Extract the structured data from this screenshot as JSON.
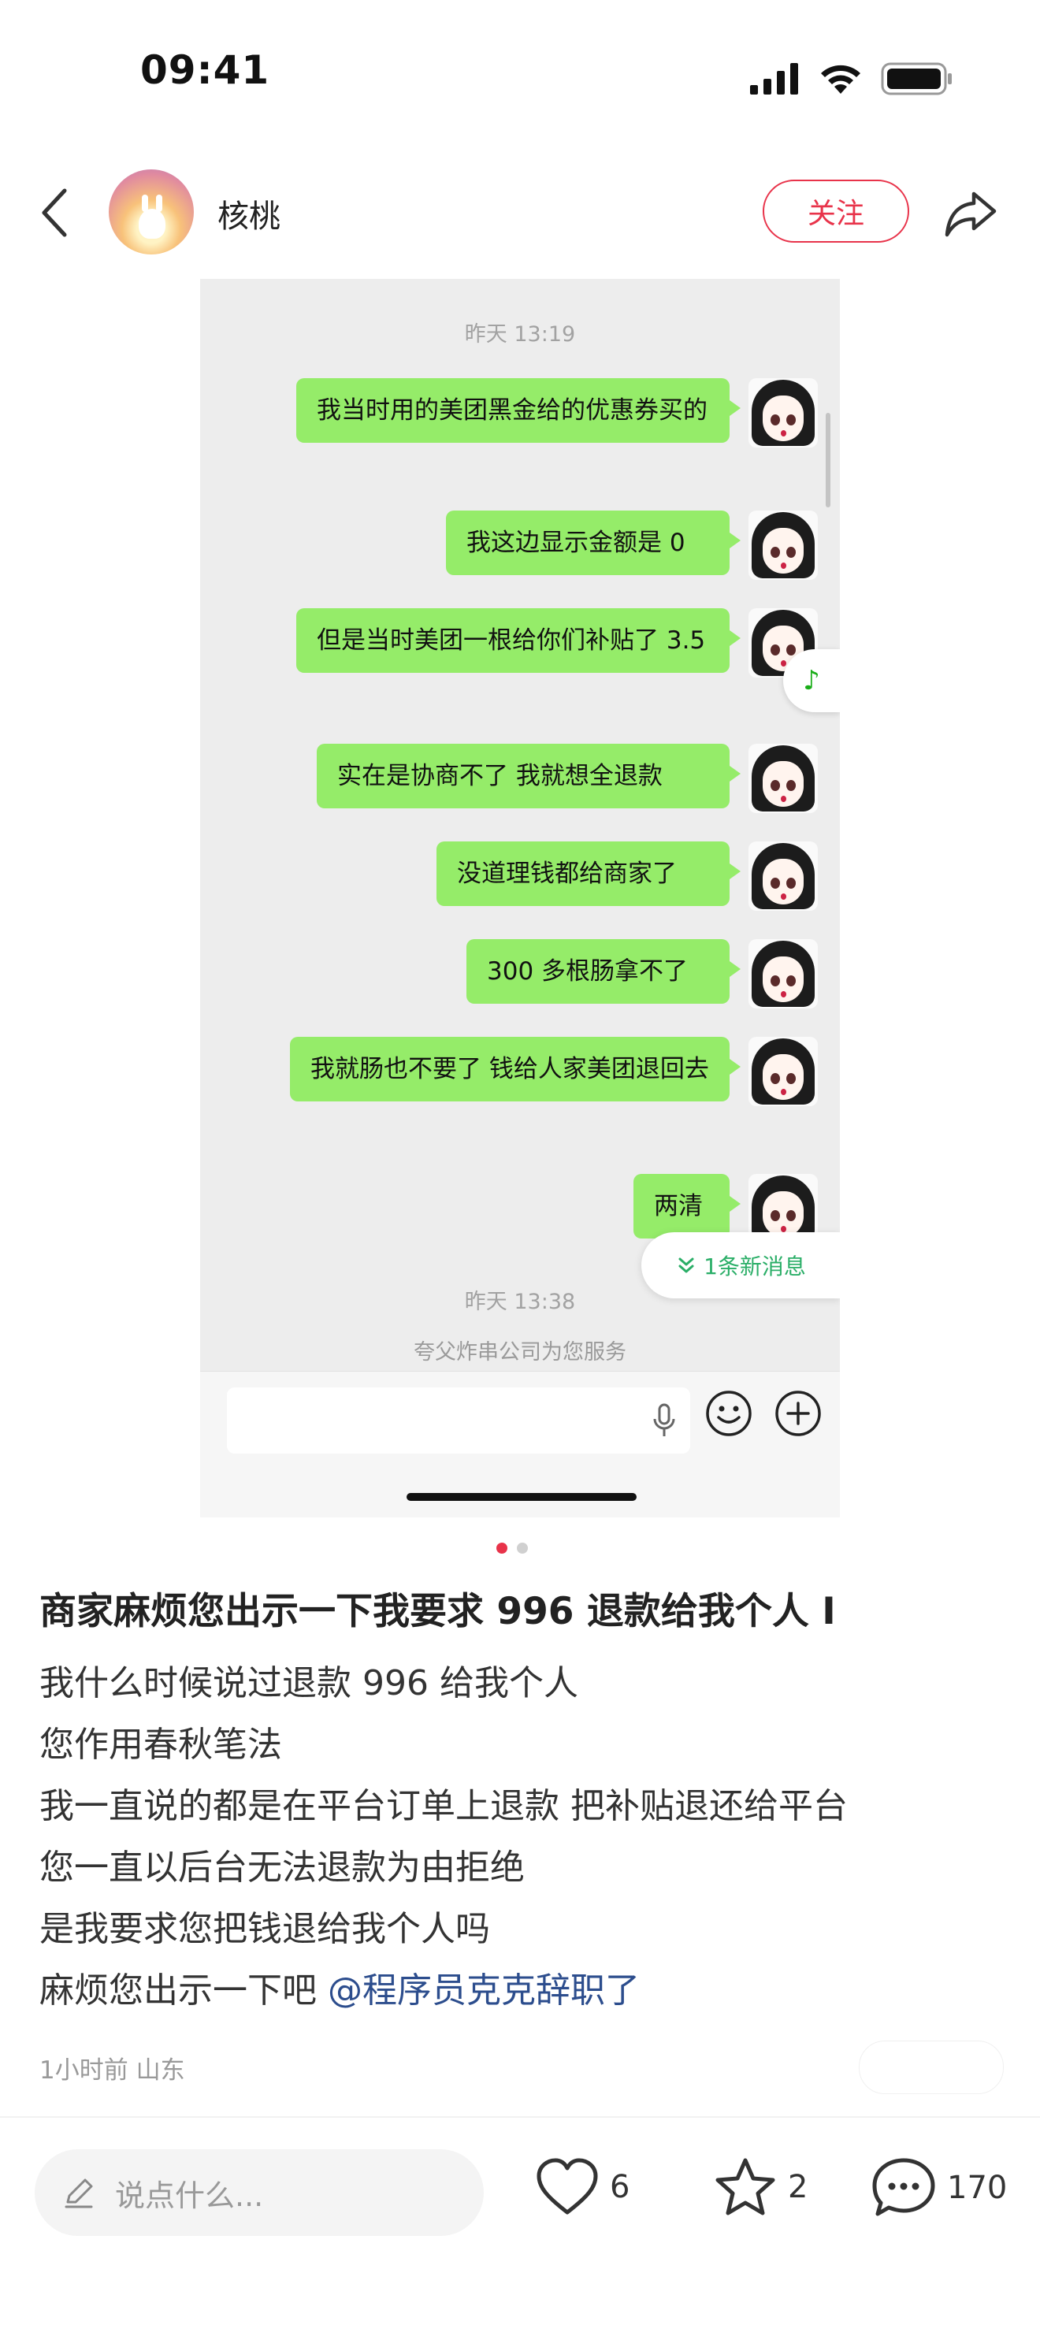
{
  "status_bar": {
    "time": "09:41"
  },
  "header": {
    "username": "核桃",
    "follow_label": "关注"
  },
  "chat": {
    "timestamp_top": "昨天 13:19",
    "messages": [
      {
        "text": "我当时用的美团黑金给的优惠券买的"
      },
      {
        "text": "我这边显示金额是 0"
      },
      {
        "text": "但是当时美团一根给你们补贴了 3.5"
      },
      {
        "text": "实在是协商不了 我就想全退款"
      },
      {
        "text": "没道理钱都给商家了"
      },
      {
        "text": "300 多根肠拿不了"
      },
      {
        "text": "我就肠也不要了 钱给人家美团退回去"
      },
      {
        "text": "两清"
      }
    ],
    "new_message_label": "1条新消息",
    "timestamp_bottom": "昨天 13:38",
    "service_text": "夸父炸串公司为您服务"
  },
  "pager": {
    "active_color": "#e8334a",
    "inactive_color": "#d0d0d0"
  },
  "post": {
    "title": "商家麻烦您出示一下我要求 996 退款给我个人 I",
    "lines": [
      "我什么时候说过退款 996 给我个人",
      "您作用春秋笔法",
      "我一直说的都是在平台订单上退款 把补贴退还给平台",
      "您一直以后台无法退款为由拒绝",
      "是我要求您把钱退给我个人吗"
    ],
    "last_line_prefix": "麻烦您出示一下吧 ",
    "mention": "@程序员克克辞职了",
    "meta": "1小时前 山东"
  },
  "bottom_bar": {
    "comment_placeholder": "说点什么...",
    "likes": "6",
    "stars": "2",
    "comments": "170"
  },
  "colors": {
    "accent": "#e8334a",
    "bubble": "#95ec69",
    "mention": "#2c4d8d",
    "new_msg": "#2aae67"
  }
}
